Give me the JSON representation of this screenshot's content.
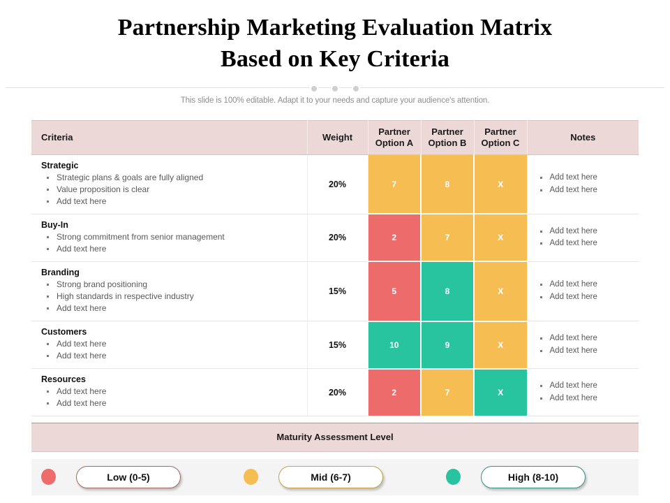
{
  "slide": {
    "title_line_1": "Partnership Marketing Evaluation Matrix",
    "title_line_2": "Based on Key Criteria",
    "subtitle": "This slide is 100% editable. Adapt it to your needs and capture your audience's attention."
  },
  "table": {
    "headers": {
      "criteria": "Criteria",
      "weight": "Weight",
      "option_a_line1": "Partner",
      "option_a_line2": "Option A",
      "option_b_line1": "Partner",
      "option_b_line2": "Option B",
      "option_c_line1": "Partner",
      "option_c_line2": "Option C",
      "notes": "Notes"
    },
    "rows": [
      {
        "criteria": "Strategic",
        "bullets": [
          "Strategic plans & goals are fully aligned",
          "Value proposition is clear",
          "Add text here"
        ],
        "weight": "20%",
        "scores": [
          {
            "value": "7",
            "level": "mid"
          },
          {
            "value": "8",
            "level": "mid"
          },
          {
            "value": "X",
            "level": "mid"
          }
        ],
        "notes": [
          "Add text here",
          "Add text here"
        ]
      },
      {
        "criteria": "Buy-In",
        "bullets": [
          "Strong commitment from senior management",
          "Add text here"
        ],
        "weight": "20%",
        "scores": [
          {
            "value": "2",
            "level": "low"
          },
          {
            "value": "7",
            "level": "mid"
          },
          {
            "value": "X",
            "level": "mid"
          }
        ],
        "notes": [
          "Add text here",
          "Add text here"
        ]
      },
      {
        "criteria": "Branding",
        "bullets": [
          "Strong brand positioning",
          "High standards in respective industry",
          "Add text here"
        ],
        "weight": "15%",
        "scores": [
          {
            "value": "5",
            "level": "low"
          },
          {
            "value": "8",
            "level": "high"
          },
          {
            "value": "X",
            "level": "mid"
          }
        ],
        "notes": [
          "Add text here",
          "Add text here"
        ]
      },
      {
        "criteria": "Customers",
        "bullets": [
          "Add text here",
          "Add text here"
        ],
        "weight": "15%",
        "scores": [
          {
            "value": "10",
            "level": "high"
          },
          {
            "value": "9",
            "level": "high"
          },
          {
            "value": "X",
            "level": "mid"
          }
        ],
        "notes": [
          "Add text here",
          "Add text here"
        ]
      },
      {
        "criteria": "Resources",
        "bullets": [
          "Add text here",
          "Add text here"
        ],
        "weight": "20%",
        "scores": [
          {
            "value": "2",
            "level": "low"
          },
          {
            "value": "7",
            "level": "mid"
          },
          {
            "value": "X",
            "level": "high"
          }
        ],
        "notes": [
          "Add text here",
          "Add text here"
        ]
      }
    ]
  },
  "maturity": {
    "label": "Maturity Assessment Level"
  },
  "legend": {
    "items": [
      {
        "label": "Low (0-5)",
        "level": "low",
        "color": "#ee6b6b",
        "pill_class": "pill-low"
      },
      {
        "label": "Mid (6-7)",
        "level": "mid",
        "color": "#f6bd53",
        "pill_class": "pill-mid"
      },
      {
        "label": "High (8-10)",
        "level": "high",
        "color": "#28c4a0",
        "pill_class": "pill-high"
      }
    ]
  },
  "colors": {
    "low": "#ee6b6b",
    "mid": "#f6bd53",
    "high": "#28c4a0",
    "header_pink": "#ecd9d7",
    "legend_band": "#f4f4f4"
  }
}
